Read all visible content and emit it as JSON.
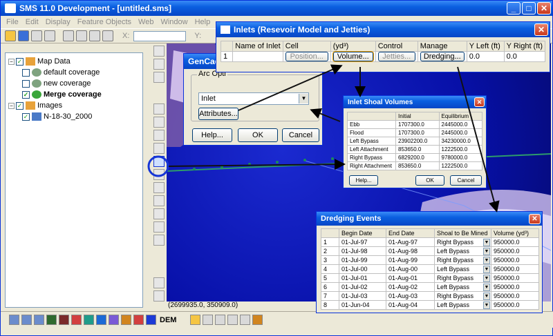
{
  "main": {
    "title": "SMS 11.0 Development - [untitled.sms]",
    "menu": [
      "File",
      "Edit",
      "Display",
      "Feature Objects",
      "Web",
      "Window",
      "Help"
    ],
    "x_label": "X:",
    "y_label": "Y:"
  },
  "tree": {
    "root": "Map Data",
    "items": [
      "default coverage",
      "new coverage",
      "Merge coverage"
    ],
    "images_label": "Images",
    "image_item": "N-18-30_2000"
  },
  "status": {
    "coords": "(2699935.0, 350909.0)"
  },
  "gencade": {
    "title": "GenCade",
    "group": "Arc Opti",
    "select_value": "Inlet",
    "attributes": "Attributes...",
    "help": "Help...",
    "ok": "OK",
    "cancel": "Cancel"
  },
  "inlets": {
    "title": "Inlets (Resevoir Model and Jetties)",
    "headers": [
      "",
      "Name of Inlet",
      "Cell",
      "(yd³)",
      "Control",
      "Manage",
      "Y Left (ft)",
      "Y Right (ft)"
    ],
    "row": {
      "num": "1",
      "name": "",
      "cell": "Position...",
      "volume": "Volume...",
      "control": "Jetties...",
      "manage": "Dredging...",
      "y_left": "0.0",
      "y_right": "0.0"
    }
  },
  "shoal": {
    "title": "Inlet Shoal Volumes",
    "headers": [
      "",
      "Initial",
      "Equilibrium"
    ],
    "rows": [
      [
        "Ebb",
        "1707300.0",
        "2445000.0"
      ],
      [
        "Flood",
        "1707300.0",
        "2445000.0"
      ],
      [
        "Left Bypass",
        "23902200.0",
        "34230000.0"
      ],
      [
        "Left Attachment",
        "853650.0",
        "1222500.0"
      ],
      [
        "Right Bypass",
        "6829200.0",
        "9780000.0"
      ],
      [
        "Right Attachment",
        "853650.0",
        "1222500.0"
      ]
    ],
    "help": "Help...",
    "ok": "OK",
    "cancel": "Cancel"
  },
  "dredging": {
    "title": "Dredging Events",
    "headers": [
      "",
      "Begin Date",
      "End Date",
      "Shoal to Be Mined",
      "Volume (yd³)"
    ],
    "rows": [
      [
        "1",
        "01-Jul-97",
        "01-Aug-97",
        "Right Bypass",
        "950000.0"
      ],
      [
        "2",
        "01-Jul-98",
        "01-Aug-98",
        "Left Bypass",
        "950000.0"
      ],
      [
        "3",
        "01-Jul-99",
        "01-Aug-99",
        "Right Bypass",
        "950000.0"
      ],
      [
        "4",
        "01-Jul-00",
        "01-Aug-00",
        "Left Bypass",
        "950000.0"
      ],
      [
        "5",
        "01-Jul-01",
        "01-Aug-01",
        "Right Bypass",
        "950000.0"
      ],
      [
        "6",
        "01-Jul-02",
        "01-Aug-02",
        "Left Bypass",
        "950000.0"
      ],
      [
        "7",
        "01-Jul-03",
        "01-Aug-03",
        "Right Bypass",
        "950000.0"
      ],
      [
        "8",
        "01-Jun-04",
        "01-Aug-04",
        "Left Bypass",
        "950000.0"
      ]
    ]
  },
  "colors": {
    "titlebar": "#0a5fe0",
    "canvas": "#0710a8",
    "highlight_circle": "#1535d6"
  }
}
